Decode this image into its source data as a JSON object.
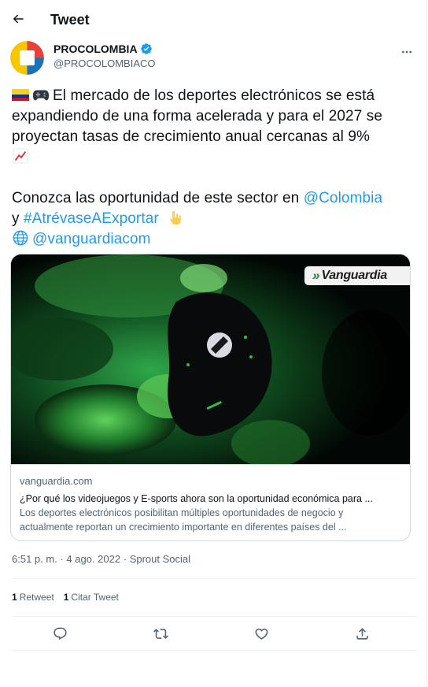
{
  "header": {
    "title": "Tweet"
  },
  "author": {
    "name": "PROCOLOMBIA",
    "handle": "@PROCOLOMBIACO"
  },
  "tweet": {
    "line1": "El mercado de los deportes electrónicos se está",
    "line2": "expandiendo de una forma acelerada y para el 2027 se",
    "line3": "proyectan tasas de crecimiento anual cercanas al 9%",
    "line4_prefix": "Conozca las oportunidad de este sector en ",
    "mention_colombia": "@Colombia",
    "line5_prefix": "y ",
    "hashtag": "#AtrévaseAExportar",
    "mention_vanguardia": "@vanguardiacom"
  },
  "card": {
    "badge": "Vanguardia",
    "domain": "vanguardia.com",
    "title": "¿Por qué los videojuegos y E-sports ahora son la oportunidad económica para ...",
    "desc_line1": "Los deportes electrónicos posibilitan múltiples oportunidades de negocio y",
    "desc_line2": "actualmente reportan un crecimiento importante en diferentes países del ..."
  },
  "meta": {
    "time": "6:51 p. m.",
    "sep1": "·",
    "date": "4 ago. 2022",
    "sep2": "·",
    "source": "Sprout Social"
  },
  "stats": {
    "retweets_count": "1",
    "retweets_label": "Retweet",
    "quotes_count": "1",
    "quotes_label": "Citar Tweet"
  },
  "icons": {
    "back": "back-arrow-icon",
    "verified": "verified-badge-icon",
    "more": "more-dots-icon",
    "reply": "reply-icon",
    "retweet": "retweet-icon",
    "like": "heart-icon",
    "share": "share-icon"
  },
  "colors": {
    "accent": "#1d9bf0",
    "text": "#0f1419",
    "secondary": "#536471",
    "border": "#cfd9de"
  }
}
